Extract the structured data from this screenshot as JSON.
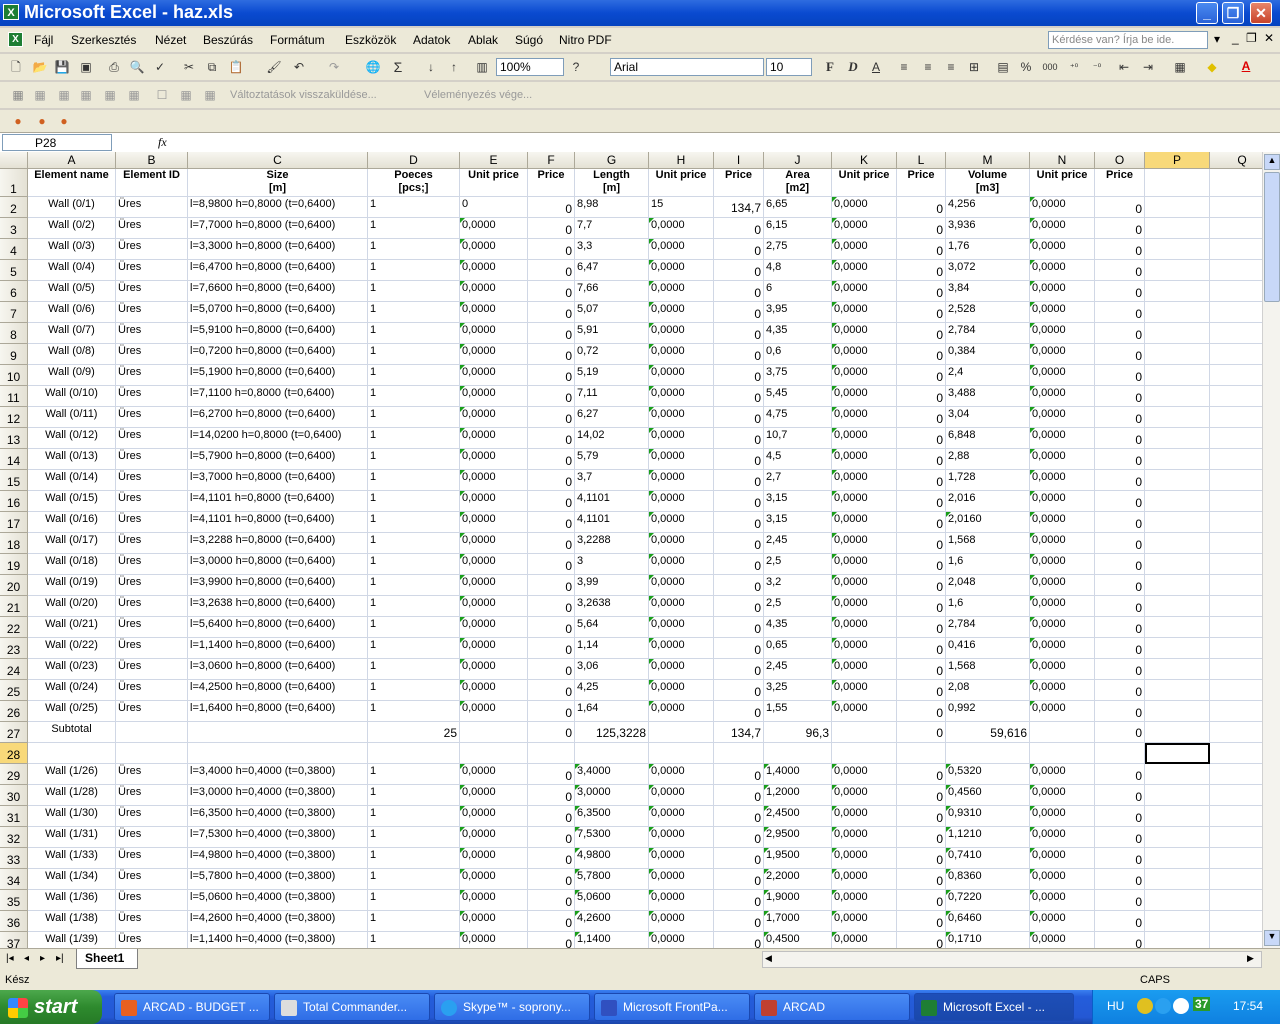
{
  "window": {
    "title": "Microsoft Excel - haz.xls",
    "minimize": "_",
    "maximize": "❐",
    "close": "✕"
  },
  "menu": {
    "items": [
      "Fájl",
      "Szerkesztés",
      "Nézet",
      "Beszúrás",
      "Formátum",
      "Eszközök",
      "Adatok",
      "Ablak",
      "Súgó",
      "Nitro PDF"
    ],
    "ask_placeholder": "Kérdése van? Írja be ide."
  },
  "toolbar": {
    "zoom": "100%",
    "font": "Arial",
    "size": "10",
    "bold": "F",
    "italic": "D",
    "underline": "A",
    "percent": "%",
    "thousands": "000",
    "review_text": "Változtatások visszaküldése...",
    "review_end": "Véleményezés vége..."
  },
  "formula": {
    "cell_ref": "P28",
    "fx": "fx"
  },
  "columns": [
    "A",
    "B",
    "C",
    "D",
    "E",
    "F",
    "G",
    "H",
    "I",
    "J",
    "K",
    "L",
    "M",
    "N",
    "O",
    "P",
    "Q"
  ],
  "headers": {
    "A": "Element name",
    "B": "Element ID",
    "C": "Size",
    "C2": "[m]",
    "D": "Poeces",
    "D2": "[pcs;]",
    "E": "Unit price",
    "F": "Price",
    "G": "Length",
    "G2": "[m]",
    "H": "Unit price",
    "I": "Price",
    "J": "Area",
    "J2": "[m2]",
    "K": "Unit price",
    "L": "Price",
    "M": "Volume",
    "M2": "[m3]",
    "N": "Unit price",
    "O": "Price"
  },
  "rows": [
    {
      "n": "2",
      "a": "Wall (0/1)",
      "b": "Üres",
      "c": "l=8,9800 h=0,8000 (t=0,6400)",
      "d": "1",
      "e": "0",
      "f": "0",
      "g": "8,98",
      "h": "15",
      "i": "134,7",
      "j": "6,65",
      "k": "0,0000",
      "l": "0",
      "m": "4,256",
      "nn": "0,0000",
      "o": "0"
    },
    {
      "n": "3",
      "a": "Wall (0/2)",
      "b": "Üres",
      "c": "l=7,7000 h=0,8000 (t=0,6400)",
      "d": "1",
      "e": "0,0000",
      "f": "0",
      "g": "7,7",
      "h": "0,0000",
      "i": "0",
      "j": "6,15",
      "k": "0,0000",
      "l": "0",
      "m": "3,936",
      "nn": "0,0000",
      "o": "0"
    },
    {
      "n": "4",
      "a": "Wall (0/3)",
      "b": "Üres",
      "c": "l=3,3000 h=0,8000 (t=0,6400)",
      "d": "1",
      "e": "0,0000",
      "f": "0",
      "g": "3,3",
      "h": "0,0000",
      "i": "0",
      "j": "2,75",
      "k": "0,0000",
      "l": "0",
      "m": "1,76",
      "nn": "0,0000",
      "o": "0"
    },
    {
      "n": "5",
      "a": "Wall (0/4)",
      "b": "Üres",
      "c": "l=6,4700 h=0,8000 (t=0,6400)",
      "d": "1",
      "e": "0,0000",
      "f": "0",
      "g": "6,47",
      "h": "0,0000",
      "i": "0",
      "j": "4,8",
      "k": "0,0000",
      "l": "0",
      "m": "3,072",
      "nn": "0,0000",
      "o": "0"
    },
    {
      "n": "6",
      "a": "Wall (0/5)",
      "b": "Üres",
      "c": "l=7,6600 h=0,8000 (t=0,6400)",
      "d": "1",
      "e": "0,0000",
      "f": "0",
      "g": "7,66",
      "h": "0,0000",
      "i": "0",
      "j": "6",
      "k": "0,0000",
      "l": "0",
      "m": "3,84",
      "nn": "0,0000",
      "o": "0"
    },
    {
      "n": "7",
      "a": "Wall (0/6)",
      "b": "Üres",
      "c": "l=5,0700 h=0,8000 (t=0,6400)",
      "d": "1",
      "e": "0,0000",
      "f": "0",
      "g": "5,07",
      "h": "0,0000",
      "i": "0",
      "j": "3,95",
      "k": "0,0000",
      "l": "0",
      "m": "2,528",
      "nn": "0,0000",
      "o": "0"
    },
    {
      "n": "8",
      "a": "Wall (0/7)",
      "b": "Üres",
      "c": "l=5,9100 h=0,8000 (t=0,6400)",
      "d": "1",
      "e": "0,0000",
      "f": "0",
      "g": "5,91",
      "h": "0,0000",
      "i": "0",
      "j": "4,35",
      "k": "0,0000",
      "l": "0",
      "m": "2,784",
      "nn": "0,0000",
      "o": "0"
    },
    {
      "n": "9",
      "a": "Wall (0/8)",
      "b": "Üres",
      "c": "l=0,7200 h=0,8000 (t=0,6400)",
      "d": "1",
      "e": "0,0000",
      "f": "0",
      "g": "0,72",
      "h": "0,0000",
      "i": "0",
      "j": "0,6",
      "k": "0,0000",
      "l": "0",
      "m": "0,384",
      "nn": "0,0000",
      "o": "0"
    },
    {
      "n": "10",
      "a": "Wall (0/9)",
      "b": "Üres",
      "c": "l=5,1900 h=0,8000 (t=0,6400)",
      "d": "1",
      "e": "0,0000",
      "f": "0",
      "g": "5,19",
      "h": "0,0000",
      "i": "0",
      "j": "3,75",
      "k": "0,0000",
      "l": "0",
      "m": "2,4",
      "nn": "0,0000",
      "o": "0"
    },
    {
      "n": "11",
      "a": "Wall (0/10)",
      "b": "Üres",
      "c": "l=7,1100 h=0,8000 (t=0,6400)",
      "d": "1",
      "e": "0,0000",
      "f": "0",
      "g": "7,11",
      "h": "0,0000",
      "i": "0",
      "j": "5,45",
      "k": "0,0000",
      "l": "0",
      "m": "3,488",
      "nn": "0,0000",
      "o": "0"
    },
    {
      "n": "12",
      "a": "Wall (0/11)",
      "b": "Üres",
      "c": "l=6,2700 h=0,8000 (t=0,6400)",
      "d": "1",
      "e": "0,0000",
      "f": "0",
      "g": "6,27",
      "h": "0,0000",
      "i": "0",
      "j": "4,75",
      "k": "0,0000",
      "l": "0",
      "m": "3,04",
      "nn": "0,0000",
      "o": "0"
    },
    {
      "n": "13",
      "a": "Wall (0/12)",
      "b": "Üres",
      "c": "l=14,0200 h=0,8000 (t=0,6400)",
      "d": "1",
      "e": "0,0000",
      "f": "0",
      "g": "14,02",
      "h": "0,0000",
      "i": "0",
      "j": "10,7",
      "k": "0,0000",
      "l": "0",
      "m": "6,848",
      "nn": "0,0000",
      "o": "0"
    },
    {
      "n": "14",
      "a": "Wall (0/13)",
      "b": "Üres",
      "c": "l=5,7900 h=0,8000 (t=0,6400)",
      "d": "1",
      "e": "0,0000",
      "f": "0",
      "g": "5,79",
      "h": "0,0000",
      "i": "0",
      "j": "4,5",
      "k": "0,0000",
      "l": "0",
      "m": "2,88",
      "nn": "0,0000",
      "o": "0"
    },
    {
      "n": "15",
      "a": "Wall (0/14)",
      "b": "Üres",
      "c": "l=3,7000 h=0,8000 (t=0,6400)",
      "d": "1",
      "e": "0,0000",
      "f": "0",
      "g": "3,7",
      "h": "0,0000",
      "i": "0",
      "j": "2,7",
      "k": "0,0000",
      "l": "0",
      "m": "1,728",
      "nn": "0,0000",
      "o": "0"
    },
    {
      "n": "16",
      "a": "Wall (0/15)",
      "b": "Üres",
      "c": "l=4,1101 h=0,8000 (t=0,6400)",
      "d": "1",
      "e": "0,0000",
      "f": "0",
      "g": "4,1101",
      "h": "0,0000",
      "i": "0",
      "j": "3,15",
      "k": "0,0000",
      "l": "0",
      "m": "2,016",
      "nn": "0,0000",
      "o": "0"
    },
    {
      "n": "17",
      "a": "Wall (0/16)",
      "b": "Üres",
      "c": "l=4,1101 h=0,8000 (t=0,6400)",
      "d": "1",
      "e": "0,0000",
      "f": "0",
      "g": "4,1101",
      "h": "0,0000",
      "i": "0",
      "j": "3,15",
      "k": "0,0000",
      "l": "0",
      "m": "2,0160",
      "nn": "0,0000",
      "o": "0"
    },
    {
      "n": "18",
      "a": "Wall (0/17)",
      "b": "Üres",
      "c": "l=3,2288 h=0,8000 (t=0,6400)",
      "d": "1",
      "e": "0,0000",
      "f": "0",
      "g": "3,2288",
      "h": "0,0000",
      "i": "0",
      "j": "2,45",
      "k": "0,0000",
      "l": "0",
      "m": "1,568",
      "nn": "0,0000",
      "o": "0"
    },
    {
      "n": "19",
      "a": "Wall (0/18)",
      "b": "Üres",
      "c": "l=3,0000 h=0,8000 (t=0,6400)",
      "d": "1",
      "e": "0,0000",
      "f": "0",
      "g": "3",
      "h": "0,0000",
      "i": "0",
      "j": "2,5",
      "k": "0,0000",
      "l": "0",
      "m": "1,6",
      "nn": "0,0000",
      "o": "0"
    },
    {
      "n": "20",
      "a": "Wall (0/19)",
      "b": "Üres",
      "c": "l=3,9900 h=0,8000 (t=0,6400)",
      "d": "1",
      "e": "0,0000",
      "f": "0",
      "g": "3,99",
      "h": "0,0000",
      "i": "0",
      "j": "3,2",
      "k": "0,0000",
      "l": "0",
      "m": "2,048",
      "nn": "0,0000",
      "o": "0"
    },
    {
      "n": "21",
      "a": "Wall (0/20)",
      "b": "Üres",
      "c": "l=3,2638 h=0,8000 (t=0,6400)",
      "d": "1",
      "e": "0,0000",
      "f": "0",
      "g": "3,2638",
      "h": "0,0000",
      "i": "0",
      "j": "2,5",
      "k": "0,0000",
      "l": "0",
      "m": "1,6",
      "nn": "0,0000",
      "o": "0"
    },
    {
      "n": "22",
      "a": "Wall (0/21)",
      "b": "Üres",
      "c": "l=5,6400 h=0,8000 (t=0,6400)",
      "d": "1",
      "e": "0,0000",
      "f": "0",
      "g": "5,64",
      "h": "0,0000",
      "i": "0",
      "j": "4,35",
      "k": "0,0000",
      "l": "0",
      "m": "2,784",
      "nn": "0,0000",
      "o": "0"
    },
    {
      "n": "23",
      "a": "Wall (0/22)",
      "b": "Üres",
      "c": "l=1,1400 h=0,8000 (t=0,6400)",
      "d": "1",
      "e": "0,0000",
      "f": "0",
      "g": "1,14",
      "h": "0,0000",
      "i": "0",
      "j": "0,65",
      "k": "0,0000",
      "l": "0",
      "m": "0,416",
      "nn": "0,0000",
      "o": "0"
    },
    {
      "n": "24",
      "a": "Wall (0/23)",
      "b": "Üres",
      "c": "l=3,0600 h=0,8000 (t=0,6400)",
      "d": "1",
      "e": "0,0000",
      "f": "0",
      "g": "3,06",
      "h": "0,0000",
      "i": "0",
      "j": "2,45",
      "k": "0,0000",
      "l": "0",
      "m": "1,568",
      "nn": "0,0000",
      "o": "0"
    },
    {
      "n": "25",
      "a": "Wall (0/24)",
      "b": "Üres",
      "c": "l=4,2500 h=0,8000 (t=0,6400)",
      "d": "1",
      "e": "0,0000",
      "f": "0",
      "g": "4,25",
      "h": "0,0000",
      "i": "0",
      "j": "3,25",
      "k": "0,0000",
      "l": "0",
      "m": "2,08",
      "nn": "0,0000",
      "o": "0"
    },
    {
      "n": "26",
      "a": "Wall (0/25)",
      "b": "Üres",
      "c": "l=1,6400 h=0,8000 (t=0,6400)",
      "d": "1",
      "e": "0,0000",
      "f": "0",
      "g": "1,64",
      "h": "0,0000",
      "i": "0",
      "j": "1,55",
      "k": "0,0000",
      "l": "0",
      "m": "0,992",
      "nn": "0,0000",
      "o": "0"
    }
  ],
  "subtotal": {
    "n": "27",
    "a": "Subtotal",
    "d": "25",
    "f": "0",
    "g": "125,3228",
    "i": "134,7",
    "j": "96,3",
    "l": "0",
    "m": "59,616",
    "o": "0"
  },
  "row28": "28",
  "rows2": [
    {
      "n": "29",
      "a": "Wall (1/26)",
      "b": "Üres",
      "c": "l=3,4000 h=0,4000 (t=0,3800)",
      "d": "1",
      "e": "0,0000",
      "f": "0",
      "g": "3,4000",
      "h": "0,0000",
      "i": "0",
      "j": "1,4000",
      "k": "0,0000",
      "l": "0",
      "m": "0,5320",
      "nn": "0,0000",
      "o": "0"
    },
    {
      "n": "30",
      "a": "Wall (1/28)",
      "b": "Üres",
      "c": "l=3,0000 h=0,4000 (t=0,3800)",
      "d": "1",
      "e": "0,0000",
      "f": "0",
      "g": "3,0000",
      "h": "0,0000",
      "i": "0",
      "j": "1,2000",
      "k": "0,0000",
      "l": "0",
      "m": "0,4560",
      "nn": "0,0000",
      "o": "0"
    },
    {
      "n": "31",
      "a": "Wall (1/30)",
      "b": "Üres",
      "c": "l=6,3500 h=0,4000 (t=0,3800)",
      "d": "1",
      "e": "0,0000",
      "f": "0",
      "g": "6,3500",
      "h": "0,0000",
      "i": "0",
      "j": "2,4500",
      "k": "0,0000",
      "l": "0",
      "m": "0,9310",
      "nn": "0,0000",
      "o": "0"
    },
    {
      "n": "32",
      "a": "Wall (1/31)",
      "b": "Üres",
      "c": "l=7,5300 h=0,4000 (t=0,3800)",
      "d": "1",
      "e": "0,0000",
      "f": "0",
      "g": "7,5300",
      "h": "0,0000",
      "i": "0",
      "j": "2,9500",
      "k": "0,0000",
      "l": "0",
      "m": "1,1210",
      "nn": "0,0000",
      "o": "0"
    },
    {
      "n": "33",
      "a": "Wall (1/33)",
      "b": "Üres",
      "c": "l=4,9800 h=0,4000 (t=0,3800)",
      "d": "1",
      "e": "0,0000",
      "f": "0",
      "g": "4,9800",
      "h": "0,0000",
      "i": "0",
      "j": "1,9500",
      "k": "0,0000",
      "l": "0",
      "m": "0,7410",
      "nn": "0,0000",
      "o": "0"
    },
    {
      "n": "34",
      "a": "Wall (1/34)",
      "b": "Üres",
      "c": "l=5,7800 h=0,4000 (t=0,3800)",
      "d": "1",
      "e": "0,0000",
      "f": "0",
      "g": "5,7800",
      "h": "0,0000",
      "i": "0",
      "j": "2,2000",
      "k": "0,0000",
      "l": "0",
      "m": "0,8360",
      "nn": "0,0000",
      "o": "0"
    },
    {
      "n": "35",
      "a": "Wall (1/36)",
      "b": "Üres",
      "c": "l=5,0600 h=0,4000 (t=0,3800)",
      "d": "1",
      "e": "0,0000",
      "f": "0",
      "g": "5,0600",
      "h": "0,0000",
      "i": "0",
      "j": "1,9000",
      "k": "0,0000",
      "l": "0",
      "m": "0,7220",
      "nn": "0,0000",
      "o": "0"
    },
    {
      "n": "36",
      "a": "Wall (1/38)",
      "b": "Üres",
      "c": "l=4,2600 h=0,4000 (t=0,3800)",
      "d": "1",
      "e": "0,0000",
      "f": "0",
      "g": "4,2600",
      "h": "0,0000",
      "i": "0",
      "j": "1,7000",
      "k": "0,0000",
      "l": "0",
      "m": "0,6460",
      "nn": "0,0000",
      "o": "0"
    },
    {
      "n": "37",
      "a": "Wall (1/39)",
      "b": "Üres",
      "c": "l=1,1400 h=0,4000 (t=0,3800)",
      "d": "1",
      "e": "0,0000",
      "f": "0",
      "g": "1,1400",
      "h": "0,0000",
      "i": "0",
      "j": "0,4500",
      "k": "0,0000",
      "l": "0",
      "m": "0,1710",
      "nn": "0,0000",
      "o": "0"
    }
  ],
  "sheet": {
    "tab": "Sheet1"
  },
  "status": {
    "left": "Kész",
    "caps": "CAPS"
  },
  "taskbar": {
    "start": "start",
    "tasks": [
      "ARCAD - BUDGET ...",
      "Total Commander...",
      "Skype™ - soprony...",
      "Microsoft FrontPa...",
      "ARCAD",
      "Microsoft Excel - ..."
    ],
    "lang": "HU",
    "badge": "37",
    "clock": "17:54"
  },
  "colors": {
    "title_blue": "#0a4ad0",
    "selected_header": "#f8d97a",
    "gridline": "#d0d7e5",
    "error_triangle": "#1a9e1a"
  }
}
